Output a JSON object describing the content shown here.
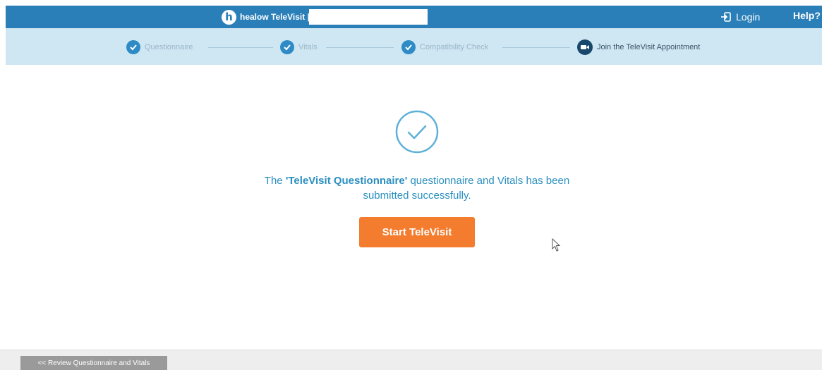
{
  "header": {
    "brand_text": "healow TeleVisit |",
    "brand_logo_letter": "h",
    "login_label": "Login",
    "help_label": "Help?"
  },
  "steps": [
    {
      "label": "Questionnaire",
      "state": "completed"
    },
    {
      "label": "Vitals",
      "state": "completed"
    },
    {
      "label": "Compatibility Check",
      "state": "completed"
    },
    {
      "label": "Join the TeleVisit Appointment",
      "state": "current"
    }
  ],
  "main": {
    "message_prefix": "The ",
    "message_bold": "'TeleVisit Questionnaire'",
    "message_line1_rest": " questionnaire and Vitals has been",
    "message_line2": "submitted successfully.",
    "start_button_label": "Start TeleVisit"
  },
  "footer": {
    "review_button_label": "<< Review Questionnaire and Vitals"
  },
  "colors": {
    "header_bg": "#2b7fb8",
    "steps_bg": "#cfe6f3",
    "accent_blue": "#2a8fc0",
    "start_button": "#f47c2e",
    "review_button": "#9a9a9a"
  },
  "icons": {
    "brand": "healow-logo-icon",
    "login": "login-icon",
    "step_done": "check-circle-icon",
    "step_current": "video-camera-icon",
    "success": "success-check-icon"
  }
}
